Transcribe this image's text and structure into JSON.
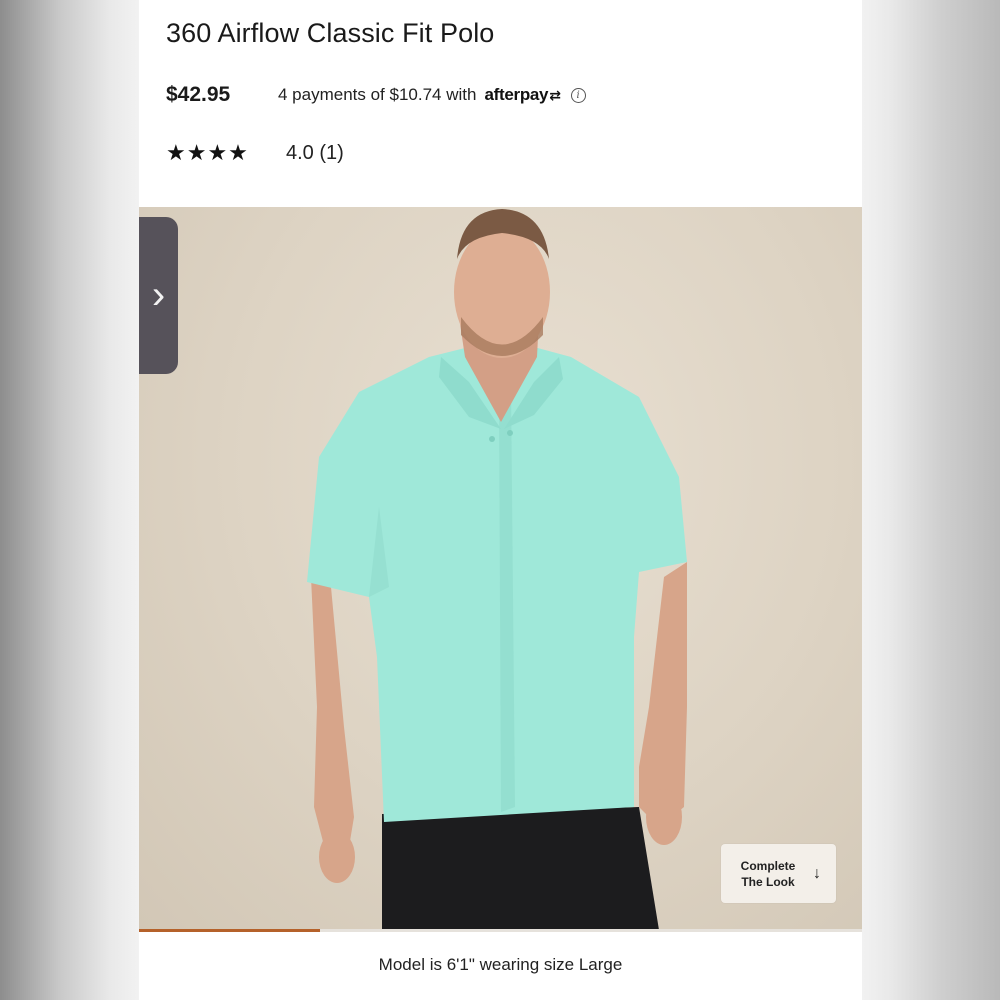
{
  "product": {
    "title": "360 Airflow Classic Fit Polo",
    "price": "$42.95",
    "installments_text": "4 payments of $10.74 with",
    "installments_provider": "afterpay",
    "stars": "★★★★",
    "rating": "4.0 (1)"
  },
  "gallery": {
    "prev_glyph": "›",
    "complete_look_line1": "Complete",
    "complete_look_line2": "The Look",
    "complete_look_arrow": "↓",
    "progress_fraction": 0.25,
    "caption": "Model is 6'1\" wearing size Large"
  },
  "icons": {
    "info": "info-icon",
    "afterpay_logo": "afterpay-arrows-icon",
    "prev": "chevron-right-icon",
    "down": "arrow-down-icon"
  },
  "colors": {
    "background": "#f2f2f2",
    "shirt": "#9fe8d9",
    "progress": "#b5612a",
    "tab": "#56525a"
  }
}
